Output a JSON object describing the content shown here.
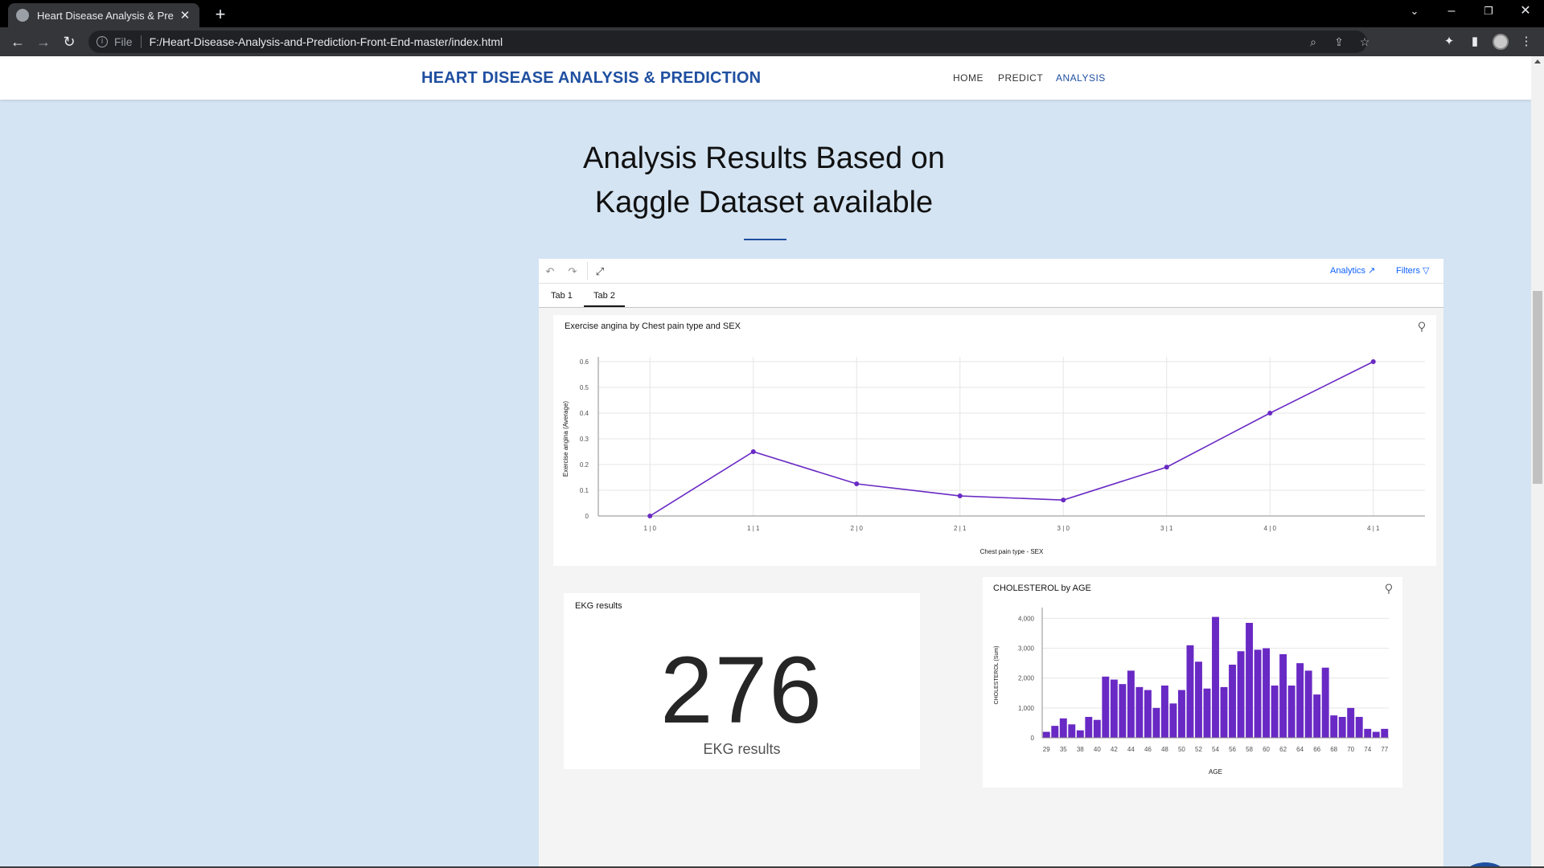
{
  "browser": {
    "tab_title": "Heart Disease Analysis & Predicti",
    "url_scheme": "File",
    "url": "F:/Heart-Disease-Analysis-and-Prediction-Front-End-master/index.html"
  },
  "site": {
    "brand": "HEART DISEASE ANALYSIS & PREDICTION",
    "nav": [
      "HOME",
      "PREDICT",
      "ANALYSIS"
    ],
    "active_nav": "ANALYSIS"
  },
  "hero": {
    "line1": "Analysis Results Based on",
    "line2": "Kaggle Dataset available"
  },
  "dashboard": {
    "toolbar": {
      "analytics": "Analytics",
      "filters": "Filters"
    },
    "tabs": [
      "Tab 1",
      "Tab 2"
    ],
    "active_tab": "Tab 2",
    "kpi": {
      "title": "EKG results",
      "value": "276",
      "label": "EKG results"
    }
  },
  "chart_data": [
    {
      "type": "line",
      "title": "Exercise angina by Chest pain type and SEX",
      "xlabel": "Chest pain type - SEX",
      "ylabel": "Exercise angina (Average)",
      "categories": [
        "1 | 0",
        "1 | 1",
        "2 | 0",
        "2 | 1",
        "3 | 0",
        "3 | 1",
        "4 | 0",
        "4 | 1"
      ],
      "values": [
        0.0,
        0.25,
        0.125,
        0.078,
        0.062,
        0.19,
        0.4,
        0.6
      ],
      "ylim": [
        0,
        0.6
      ],
      "yticks": [
        "0",
        "0.1",
        "0.2",
        "0.3",
        "0.4",
        "0.5",
        "0.6"
      ],
      "color": "#6929c4",
      "grid": true
    },
    {
      "type": "bar",
      "title": "CHOLESTEROL by AGE",
      "xlabel": "AGE",
      "ylabel": "CHOLESTEROL (Sum)",
      "categories": [
        29,
        34,
        35,
        37,
        38,
        39,
        40,
        41,
        42,
        43,
        44,
        45,
        46,
        47,
        48,
        49,
        50,
        51,
        52,
        53,
        54,
        55,
        56,
        57,
        58,
        59,
        60,
        61,
        62,
        63,
        64,
        65,
        66,
        67,
        68,
        69,
        70,
        71,
        74,
        76,
        77
      ],
      "tick_labels": [
        "29",
        "35",
        "38",
        "40",
        "42",
        "44",
        "46",
        "48",
        "50",
        "52",
        "54",
        "56",
        "58",
        "60",
        "62",
        "64",
        "66",
        "68",
        "70",
        "74",
        "77"
      ],
      "values": [
        200,
        400,
        650,
        450,
        250,
        700,
        600,
        2050,
        1950,
        1800,
        2250,
        1700,
        1600,
        1000,
        1750,
        1150,
        1600,
        3100,
        2550,
        1650,
        4050,
        1700,
        2450,
        2900,
        3850,
        2950,
        3000,
        1750,
        2800,
        1750,
        2500,
        2250,
        1450,
        2350,
        750,
        700,
        1000,
        700,
        300,
        200,
        300
      ],
      "ylim": [
        0,
        4200
      ],
      "yticks": [
        "0",
        "1,000",
        "2,000",
        "3,000",
        "4,000"
      ],
      "color": "#6929c4",
      "grid": true
    }
  ]
}
